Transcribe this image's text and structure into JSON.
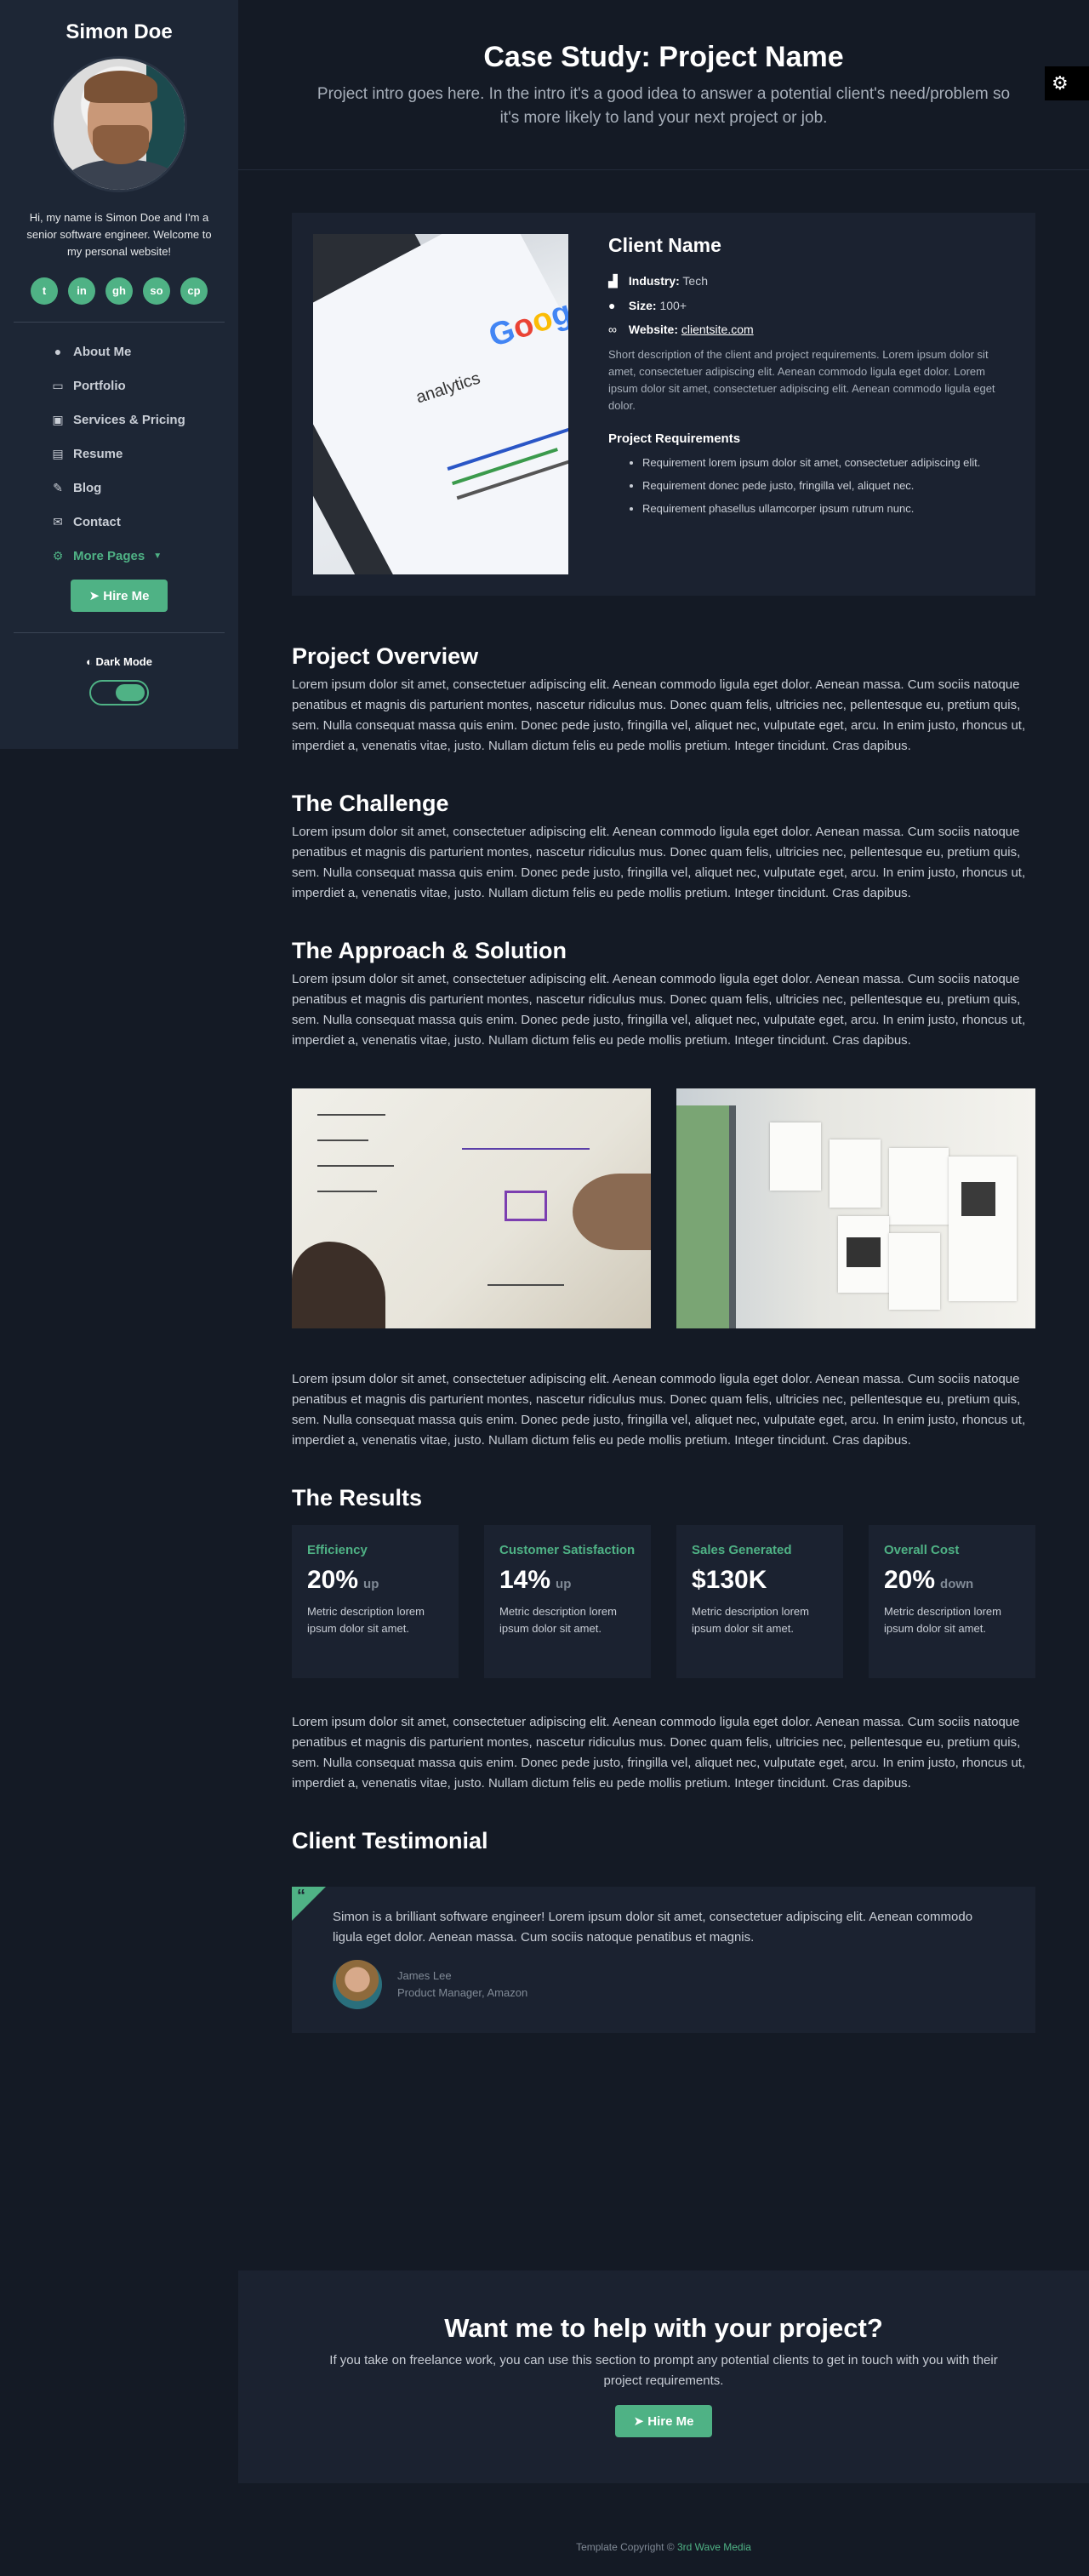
{
  "sidebar": {
    "name": "Simon Doe",
    "bio": "Hi, my name is Simon Doe and I'm a senior software engineer. Welcome to my personal website!",
    "socials": [
      {
        "icon": "twitter-icon",
        "glyph": "t"
      },
      {
        "icon": "linkedin-icon",
        "glyph": "in"
      },
      {
        "icon": "github-icon",
        "glyph": "gh"
      },
      {
        "icon": "stack-overflow-icon",
        "glyph": "so"
      },
      {
        "icon": "codepen-icon",
        "glyph": "cp"
      }
    ],
    "nav": [
      {
        "label": "About Me",
        "icon": "user-icon",
        "glyph": "●"
      },
      {
        "label": "Portfolio",
        "icon": "laptop-icon",
        "glyph": "▭"
      },
      {
        "label": "Services & Pricing",
        "icon": "briefcase-icon",
        "glyph": "▣"
      },
      {
        "label": "Resume",
        "icon": "file-icon",
        "glyph": "▤"
      },
      {
        "label": "Blog",
        "icon": "blog-icon",
        "glyph": "✎"
      },
      {
        "label": "Contact",
        "icon": "envelope-icon",
        "glyph": "✉"
      }
    ],
    "more_pages": "More Pages",
    "hire_label": "Hire Me",
    "dark_mode_label": "Dark Mode"
  },
  "header": {
    "title": "Case Study: Project Name",
    "intro": "Project intro goes here. In the intro it's a good idea to answer a potential client's need/problem so it's more likely to land your next project or job."
  },
  "client": {
    "name": "Client Name",
    "industry_label": "Industry:",
    "industry": "Tech",
    "size_label": "Size:",
    "size": "100+",
    "website_label": "Website:",
    "website": "clientsite.com",
    "description": "Short description of the client and project requirements. Lorem ipsum dolor sit amet, consectetuer adipiscing elit. Aenean commodo ligula eget dolor. Lorem ipsum dolor sit amet, consectetuer adipiscing elit. Aenean commodo ligula eget dolor.",
    "requirements_title": "Project Requirements",
    "requirements": [
      "Requirement lorem ipsum dolor sit amet, consectetuer adipiscing elit.",
      "Requirement donec pede justo, fringilla vel, aliquet nec.",
      "Requirement phasellus ullamcorper ipsum rutrum nunc."
    ],
    "image_search_query": "analytics"
  },
  "sections": {
    "overview_title": "Project Overview",
    "challenge_title": "The Challenge",
    "approach_title": "The Approach & Solution",
    "results_title": "The Results",
    "testimonial_title": "Client Testimonial",
    "lorem": "Lorem ipsum dolor sit amet, consectetuer adipiscing elit. Aenean commodo ligula eget dolor. Aenean massa. Cum sociis natoque penatibus et magnis dis parturient montes, nascetur ridiculus mus. Donec quam felis, ultricies nec, pellentesque eu, pretium quis, sem. Nulla consequat massa quis enim. Donec pede justo, fringilla vel, aliquet nec, vulputate eget, arcu. In enim justo, rhoncus ut, imperdiet a, venenatis vitae, justo. Nullam dictum felis eu pede mollis pretium. Integer tincidunt. Cras dapibus."
  },
  "results": [
    {
      "label": "Efficiency",
      "value": "20%",
      "trend": "up",
      "desc": "Metric description lorem ipsum dolor sit amet."
    },
    {
      "label": "Customer Satisfaction",
      "value": "14%",
      "trend": "up",
      "desc": "Metric description lorem ipsum dolor sit amet."
    },
    {
      "label": "Sales Generated",
      "value": "$130K",
      "trend": "",
      "desc": "Metric description lorem ipsum dolor sit amet."
    },
    {
      "label": "Overall Cost",
      "value": "20%",
      "trend": "down",
      "desc": "Metric description lorem ipsum dolor sit amet."
    }
  ],
  "testimonial": {
    "text": "Simon is a brilliant software engineer! Lorem ipsum dolor sit amet, consectetuer adipiscing elit. Aenean commodo ligula eget dolor. Aenean massa. Cum sociis natoque penatibus et magnis.",
    "author": "James Lee",
    "role": "Product Manager, Amazon"
  },
  "cta": {
    "title": "Want me to help with your project?",
    "text": "If you take on freelance work, you can use this section to prompt any potential clients to get in touch with you with their project requirements.",
    "hire_label": "Hire Me"
  },
  "footer": {
    "copyright": "Template Copyright ©",
    "brand": "3rd Wave Media"
  },
  "colors": {
    "accent": "#4fb285",
    "background": "#141a25",
    "sidebar": "#1d2635",
    "card": "#1b2230"
  }
}
